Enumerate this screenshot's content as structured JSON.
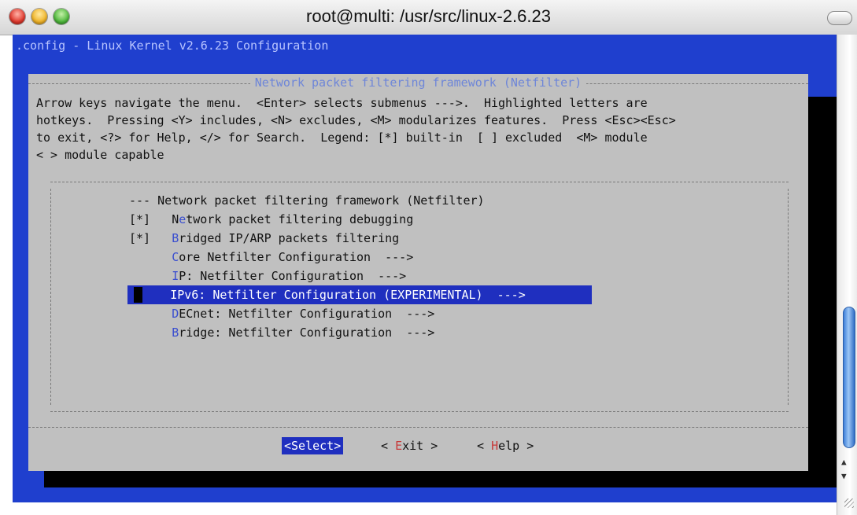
{
  "window": {
    "title": "root@multi: /usr/src/linux-2.6.23"
  },
  "terminal": {
    "header": ".config - Linux Kernel v2.6.23 Configuration",
    "background": "#1f3fce"
  },
  "dialog": {
    "title": "Network packet filtering framework (Netfilter)",
    "instructions": [
      "Arrow keys navigate the menu.  <Enter> selects submenus --->.  Highlighted letters are",
      "hotkeys.  Pressing <Y> includes, <N> excludes, <M> modularizes features.  Press <Esc><Esc>",
      "to exit, <?> for Help, </> for Search.  Legend: [*] built-in  [ ] excluded  <M> module",
      "< > module capable"
    ],
    "menu_items": [
      {
        "prefix": "--- ",
        "hotkey": "",
        "rest": "Network packet filtering framework (Netfilter)"
      },
      {
        "prefix": "[*]   ",
        "pre": "N",
        "hotkey": "e",
        "rest": "twork packet filtering debugging"
      },
      {
        "prefix": "[*]   ",
        "hotkey": "B",
        "rest": "ridged IP/ARP packets filtering"
      },
      {
        "prefix": "      ",
        "hotkey": "C",
        "rest": "ore Netfilter Configuration  --->"
      },
      {
        "prefix": "      ",
        "hotkey": "I",
        "rest": "P: Netfilter Configuration  --->"
      },
      {
        "prefix": "      ",
        "hotkey": "",
        "rest": "IPv6: Netfilter Configuration (EXPERIMENTAL)  --->",
        "selected": true
      },
      {
        "prefix": "      ",
        "hotkey": "D",
        "rest": "ECnet: Netfilter Configuration  --->"
      },
      {
        "prefix": "      ",
        "hotkey": "B",
        "rest": "ridge: Netfilter Configuration  --->"
      }
    ],
    "buttons": {
      "select": "<Select>",
      "exit_pre": "< ",
      "exit_hot": "E",
      "exit_rest": "xit >",
      "help_pre": "< ",
      "help_hot": "H",
      "help_rest": "elp >"
    }
  }
}
